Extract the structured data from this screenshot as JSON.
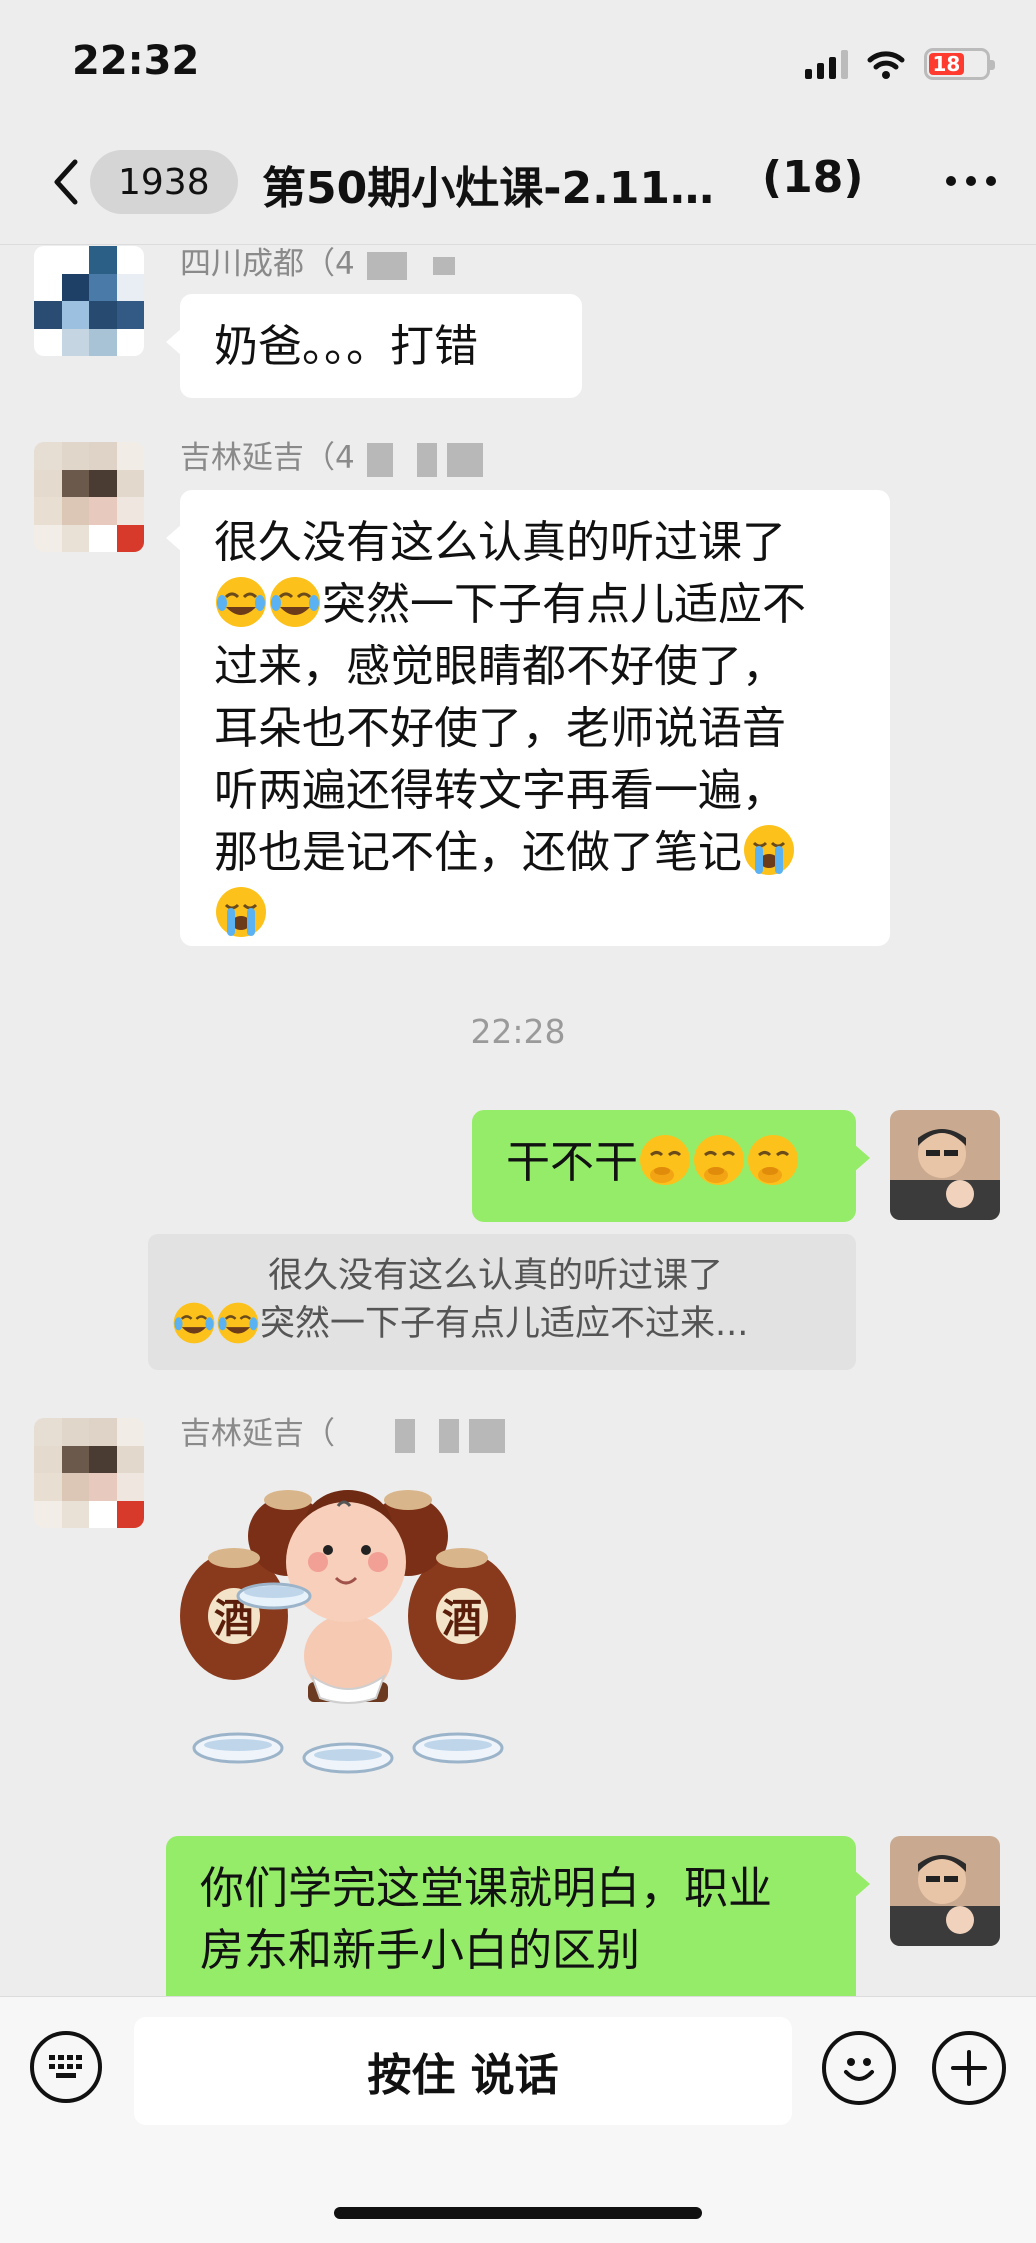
{
  "status_bar": {
    "time": "22:32",
    "battery": "18"
  },
  "nav": {
    "unread": "1938",
    "title": "第50期小灶课-2.11…",
    "member_count": "(18)"
  },
  "messages": [
    {
      "side": "left",
      "sender": "四川成都（4",
      "text": "奶爸。。。打错"
    },
    {
      "side": "left",
      "sender": "吉林延吉（4",
      "lines": [
        "很久没有这么认真的听过课了",
        "突然一下子有点儿适应不",
        "过来，感觉眼睛都不好使了，",
        "耳朵也不好使了，老师说语音",
        "听两遍还得转文字再看一遍，",
        "那也是记不住，还做了笔记"
      ],
      "emojis": [
        "tearful-laugh",
        "tearful-laugh",
        "crying",
        "crying"
      ]
    },
    {
      "type": "time",
      "text": "22:28"
    },
    {
      "side": "right",
      "text": "干不干",
      "emojis": [
        "shushing",
        "shushing",
        "shushing"
      ]
    },
    {
      "type": "quote",
      "line1": "很久没有这么认真的听过课了",
      "line2": "突然一下子有点儿适应不过来..."
    },
    {
      "side": "left",
      "sender": "吉林延吉（",
      "sticker": "baby-drinking-wine-sticker",
      "sticker_text": "酒"
    },
    {
      "side": "right",
      "lines": [
        "你们学完这堂课就明白，职业",
        "房东和新手小白的区别"
      ]
    }
  ],
  "input_bar": {
    "hold_to_talk": "按住 说话"
  },
  "colors": {
    "background": "#ededed",
    "bubble_self": "#95ec69",
    "bubble_other": "#ffffff"
  }
}
